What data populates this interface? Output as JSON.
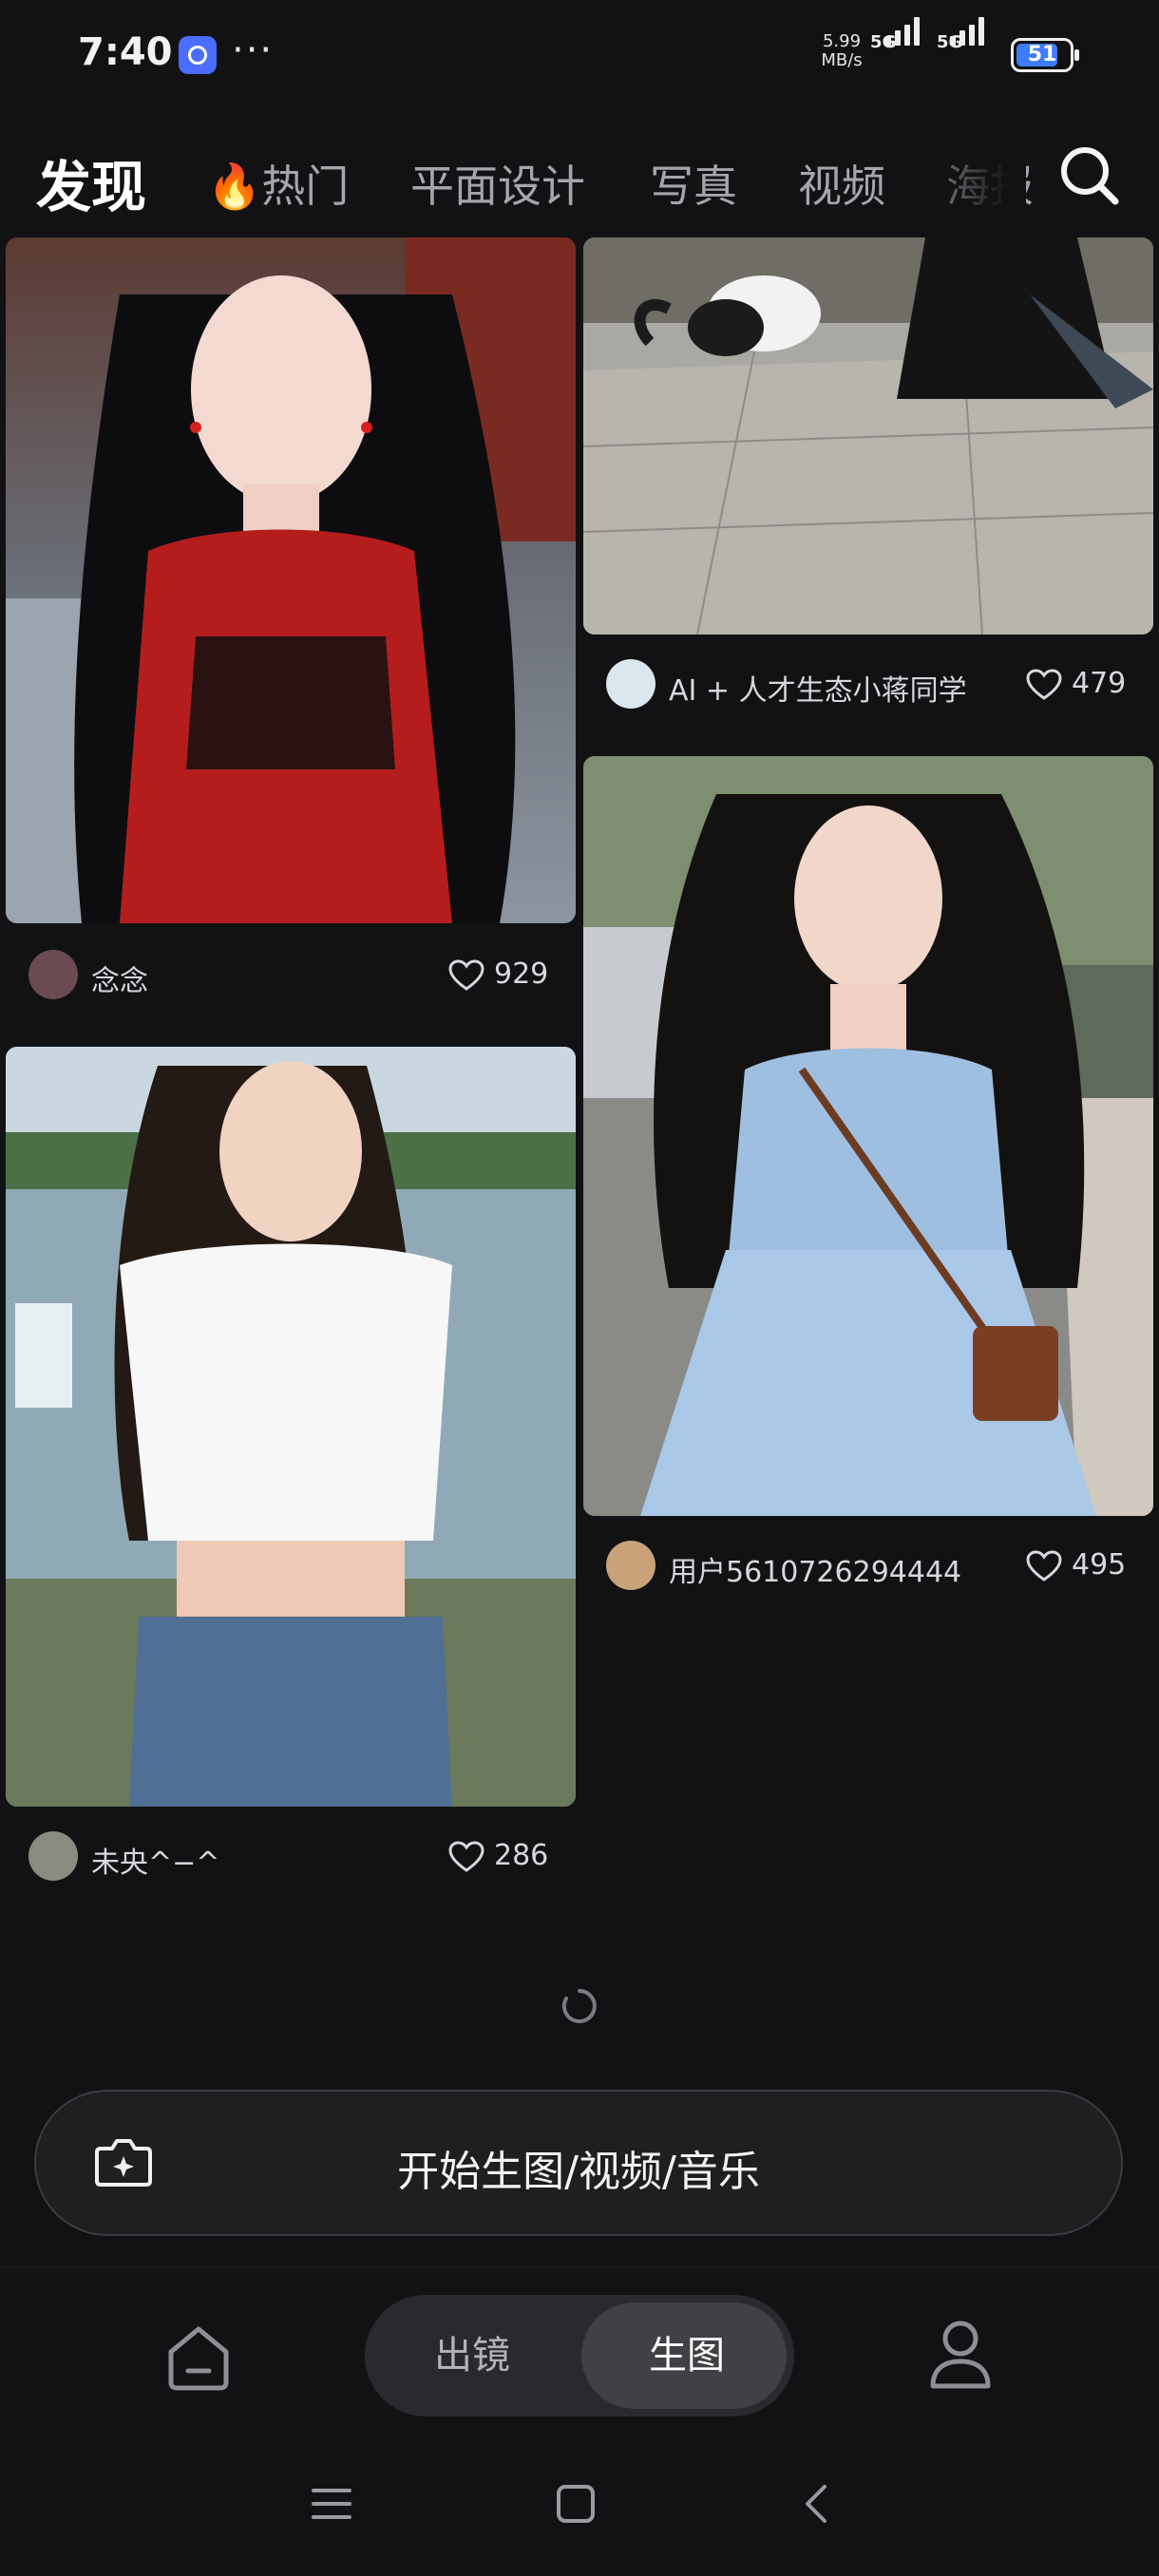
{
  "status_bar": {
    "time": "7:40",
    "more": "···",
    "speed_value": "5.99",
    "speed_unit": "MB/s",
    "network_1": "5G",
    "network_2": "5G",
    "battery": "51"
  },
  "top_tabs": {
    "active": "发现",
    "items": [
      "🔥热门",
      "平面设计",
      "写真",
      "视频",
      "海报"
    ]
  },
  "feed": {
    "left": [
      {
        "author": "念念",
        "likes": "929",
        "image": "portrait-woman-red-hanfu"
      },
      {
        "author": "未央^−^",
        "likes": "286",
        "image": "portrait-woman-white-tee-lakeside"
      }
    ],
    "right": [
      {
        "author": "AI + 人才生态小蒋同学",
        "likes": "479",
        "image": "video-cat-and-swordsman-courtyard"
      },
      {
        "author": "用户5610726294444",
        "likes": "495",
        "image": "portrait-woman-blue-dress-street"
      }
    ]
  },
  "create_bar": {
    "label": "开始生图/视频/音乐",
    "icon": "camera-sparkle-icon"
  },
  "bottom_nav": {
    "segment": [
      "出镜",
      "生图"
    ],
    "selected": "生图",
    "home_icon": "home-icon",
    "profile_icon": "person-icon"
  },
  "colors": {
    "background": "#121214",
    "accent_blue": "#3e7cff",
    "text_secondary": "#a5a5ab"
  }
}
